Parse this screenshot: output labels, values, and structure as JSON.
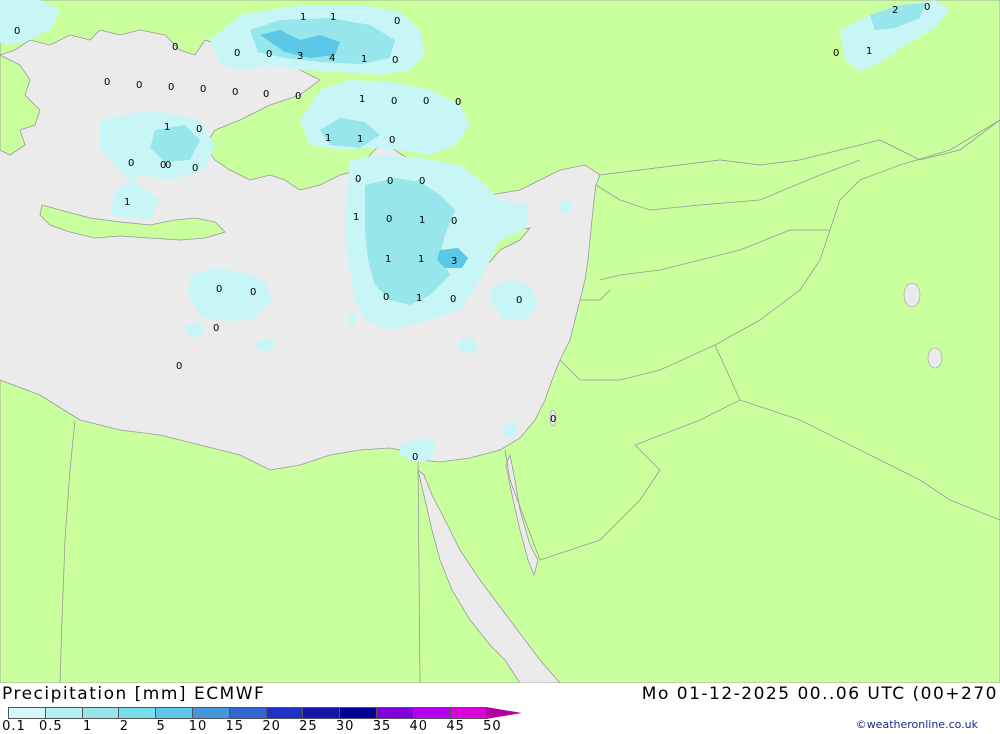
{
  "title": "Precipitation [mm] ECMWF",
  "timestamp": "Mo 01-12-2025 00..06 UTC (00+270",
  "credit": "©weatheronline.co.uk",
  "legend": {
    "ticks": [
      "0.1",
      "0.5",
      "1",
      "2",
      "5",
      "10",
      "15",
      "20",
      "25",
      "30",
      "35",
      "40",
      "45",
      "50"
    ],
    "colors": [
      "#d7f8f8",
      "#b4f0f0",
      "#96e6ec",
      "#78dcec",
      "#5ac8e6",
      "#4696dc",
      "#3264d2",
      "#1e32c8",
      "#1414aa",
      "#000096",
      "#8200dc",
      "#b400f0",
      "#dc00dc",
      "#b4009e"
    ]
  },
  "map_colors": {
    "land": "#caff9e",
    "sea": "#ebebeb",
    "border": "#999999",
    "rain_light": "#c8f5f5",
    "rain_medium": "#96e6ec",
    "rain_heavy": "#5ac8e6"
  },
  "precip_values": [
    "0",
    "1",
    "1",
    "0",
    "0",
    "0",
    "3",
    "4",
    "1",
    "0",
    "0",
    "0",
    "0",
    "0",
    "0",
    "0",
    "0",
    "0",
    "0",
    "1",
    "0",
    "0",
    "0",
    "1",
    "1",
    "0",
    "1",
    "0",
    "0",
    "0",
    "0",
    "1",
    "0",
    "0",
    "0",
    "1",
    "0",
    "1",
    "0",
    "1",
    "1",
    "3",
    "0",
    "1",
    "0",
    "0",
    "0",
    "0",
    "0",
    "0",
    "0",
    "0",
    "2",
    "0",
    "0",
    "1"
  ]
}
